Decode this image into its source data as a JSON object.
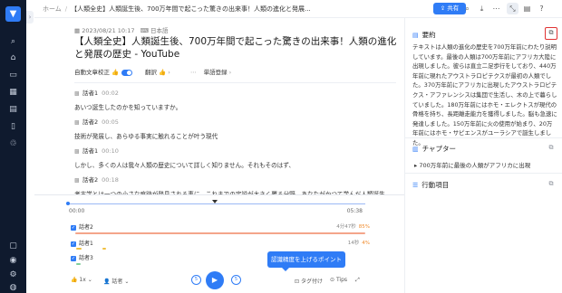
{
  "breadcrumb": {
    "home": "ホーム",
    "current": "【人類全史】人類誕生後、700万年間で起こった驚きの出来事！人類の進化と発展..."
  },
  "toolbar": {
    "share_label": "共有"
  },
  "document": {
    "meta": "2023/08/21 10:17",
    "language": "日本語",
    "title": "【人類全史】人類誕生後、700万年間で起こった驚きの出来事！人類の進化と発展の歴史 - YouTube",
    "auto_correct_label": "自動文章校正",
    "translate_label": "翻訳",
    "word_register_label": "単語登録"
  },
  "segments": [
    {
      "speaker": "話者1",
      "time": "00:02",
      "text": "あいつ誕生したのかを知っていますか。"
    },
    {
      "speaker": "話者2",
      "time": "00:05",
      "text": "技術が発展し、あらゆる事実に触れることが叶う現代"
    },
    {
      "speaker": "話者1",
      "time": "00:10",
      "text": "しかし、多くの人は我々人類の歴史について詳しく知りません。それもそのはず、"
    },
    {
      "speaker": "話者2",
      "time": "00:18",
      "text": "考古学とは一つの小さな痕跡が発見される事に、これまでの定説が大きく覆る分野。あなたがかつて学んだ人類誕生"
    }
  ],
  "summary": {
    "heading": "要約",
    "text": "テキストは人類の進化の歴史を700万年前にわたり説明しています。最後の人類は700万年前にアフリカ大陸に出現しました。彼らは直立二足歩行をしており、440万年前に現れたアウストラロピテクスが最初の人類でした。370万年前にアフリカに出現したアウストラロピテクス・アファレンシスは集団で生活し、木の上で暮らしていました。180万年前にはホモ・エレクトスが現代の骨格を持ち、長距離走能力を獲得しました。脳も急速に発達しました。150万年前に火の使用が始まり、20万年前にはホモ・サピエンスがユーラシアで誕生しました。"
  },
  "chapters": {
    "heading": "チャプター",
    "items": [
      "700万年前に最後の人類がアフリカに出現"
    ]
  },
  "actions": {
    "heading": "行動項目"
  },
  "player": {
    "time_start": "00:00",
    "time_end": "05:38",
    "speakers": [
      {
        "name": "話者2",
        "time": "4分47秒",
        "pct": "85%"
      },
      {
        "name": "話者1",
        "time": "14秒",
        "pct": "4%"
      },
      {
        "name": "話者3",
        "time": "",
        "pct": ""
      }
    ],
    "tooltip": "認識精度を上げるポイント",
    "speed": "1x",
    "speaker_filter": "話者",
    "skip_back": "5",
    "skip_fwd": "5",
    "tag_label": "タグ付け",
    "tips_label": "Tips"
  },
  "colors": {
    "accent": "#2f7cf6",
    "sidebar": "#0f1a2e",
    "highlight": "#e03232",
    "speaker_bar": "#f08c2e"
  }
}
